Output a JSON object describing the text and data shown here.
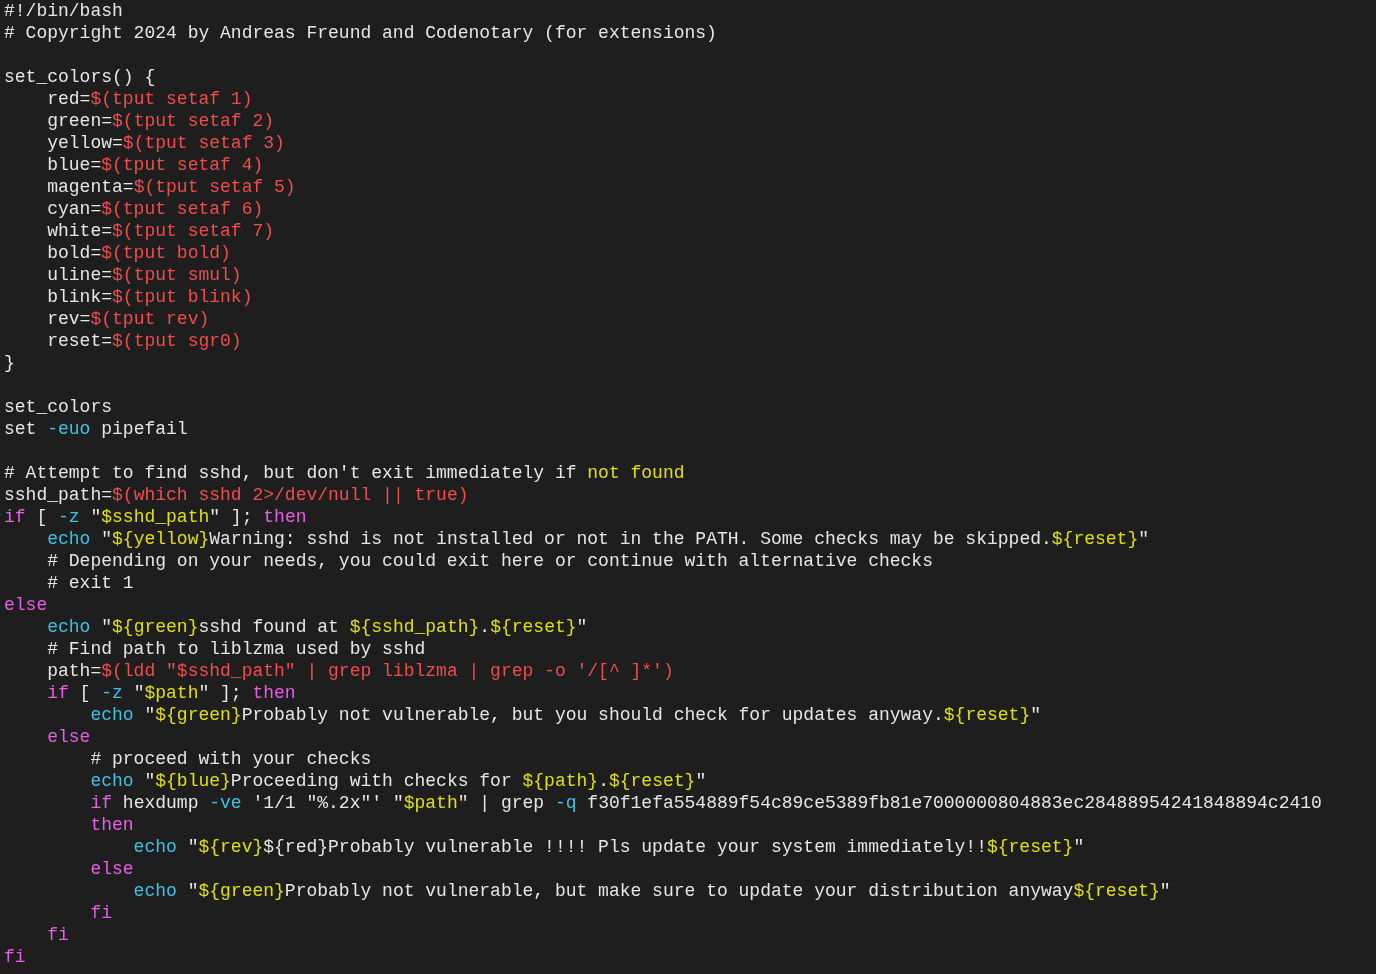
{
  "editor": {
    "lines": [
      {
        "tokens": [
          {
            "text": "#!/bin/bash",
            "color": "#e6e6e6"
          }
        ]
      },
      {
        "tokens": [
          {
            "text": "# Copyright 2024 by Andreas Freund and Codenotary (for extensions)",
            "color": "#e6e6e6"
          }
        ]
      },
      {
        "kind": "blank"
      },
      {
        "tokens": [
          {
            "text": "set_colors() {",
            "color": "#e6e6e6"
          }
        ]
      },
      {
        "tokens": [
          {
            "text": "    red=",
            "color": "#e6e6e6"
          },
          {
            "text": "$(tput setaf 1)",
            "color": "#f14c4c"
          }
        ]
      },
      {
        "tokens": [
          {
            "text": "    green=",
            "color": "#e6e6e6"
          },
          {
            "text": "$(tput setaf 2)",
            "color": "#f14c4c"
          }
        ]
      },
      {
        "tokens": [
          {
            "text": "    yellow=",
            "color": "#e6e6e6"
          },
          {
            "text": "$(tput setaf 3)",
            "color": "#f14c4c"
          }
        ]
      },
      {
        "tokens": [
          {
            "text": "    blue=",
            "color": "#e6e6e6"
          },
          {
            "text": "$(tput setaf 4)",
            "color": "#f14c4c"
          }
        ]
      },
      {
        "tokens": [
          {
            "text": "    magenta=",
            "color": "#e6e6e6"
          },
          {
            "text": "$(tput setaf 5)",
            "color": "#f14c4c"
          }
        ]
      },
      {
        "tokens": [
          {
            "text": "    cyan=",
            "color": "#e6e6e6"
          },
          {
            "text": "$(tput setaf 6)",
            "color": "#f14c4c"
          }
        ]
      },
      {
        "tokens": [
          {
            "text": "    white=",
            "color": "#e6e6e6"
          },
          {
            "text": "$(tput setaf 7)",
            "color": "#f14c4c"
          }
        ]
      },
      {
        "tokens": [
          {
            "text": "    bold=",
            "color": "#e6e6e6"
          },
          {
            "text": "$(tput bold)",
            "color": "#f14c4c"
          }
        ]
      },
      {
        "tokens": [
          {
            "text": "    uline=",
            "color": "#e6e6e6"
          },
          {
            "text": "$(tput smul)",
            "color": "#f14c4c"
          }
        ]
      },
      {
        "tokens": [
          {
            "text": "    blink=",
            "color": "#e6e6e6"
          },
          {
            "text": "$(tput blink)",
            "color": "#f14c4c"
          }
        ]
      },
      {
        "tokens": [
          {
            "text": "    rev=",
            "color": "#e6e6e6"
          },
          {
            "text": "$(tput rev)",
            "color": "#f14c4c"
          }
        ]
      },
      {
        "tokens": [
          {
            "text": "    reset=",
            "color": "#e6e6e6"
          },
          {
            "text": "$(tput sgr0)",
            "color": "#f14c4c"
          }
        ]
      },
      {
        "tokens": [
          {
            "text": "}",
            "color": "#e6e6e6"
          }
        ]
      },
      {
        "kind": "blank"
      },
      {
        "tokens": [
          {
            "text": "set_colors",
            "color": "#e6e6e6"
          }
        ]
      },
      {
        "tokens": [
          {
            "text": "set ",
            "color": "#e6e6e6"
          },
          {
            "text": "-euo",
            "color": "#3ec3e8"
          },
          {
            "text": " pipefail",
            "color": "#e6e6e6"
          }
        ]
      },
      {
        "kind": "blank"
      },
      {
        "tokens": [
          {
            "text": "# Attempt to find sshd, but don't exit immediately if ",
            "color": "#e6e6e6"
          },
          {
            "text": "not found",
            "color": "#e0e010"
          }
        ]
      },
      {
        "tokens": [
          {
            "text": "sshd_path=",
            "color": "#e6e6e6"
          },
          {
            "text": "$(which sshd 2>/dev/null || true)",
            "color": "#f14c4c"
          }
        ]
      },
      {
        "tokens": [
          {
            "text": "if",
            "color": "#e85ee8"
          },
          {
            "text": " [ ",
            "color": "#e6e6e6"
          },
          {
            "text": "-z",
            "color": "#3ec3e8"
          },
          {
            "text": " \"",
            "color": "#e6e6e6"
          },
          {
            "text": "$sshd_path",
            "color": "#e0e010"
          },
          {
            "text": "\" ]; ",
            "color": "#e6e6e6"
          },
          {
            "text": "then",
            "color": "#e85ee8"
          }
        ]
      },
      {
        "tokens": [
          {
            "text": "    echo",
            "color": "#3ec3e8"
          },
          {
            "text": " \"",
            "color": "#e6e6e6"
          },
          {
            "text": "${yellow}",
            "color": "#e0e010"
          },
          {
            "text": "Warning: sshd is not installed or not in the PATH. Some checks may be skipped.",
            "color": "#e6e6e6"
          },
          {
            "text": "${reset}",
            "color": "#e0e010"
          },
          {
            "text": "\"",
            "color": "#e6e6e6"
          }
        ]
      },
      {
        "tokens": [
          {
            "text": "    # Depending on your needs, you could exit here or continue with alternative checks",
            "color": "#e6e6e6"
          }
        ]
      },
      {
        "tokens": [
          {
            "text": "    # exit 1",
            "color": "#e6e6e6"
          }
        ]
      },
      {
        "tokens": [
          {
            "text": "else",
            "color": "#e85ee8"
          }
        ]
      },
      {
        "tokens": [
          {
            "text": "    echo",
            "color": "#3ec3e8"
          },
          {
            "text": " \"",
            "color": "#e6e6e6"
          },
          {
            "text": "${green}",
            "color": "#e0e010"
          },
          {
            "text": "sshd found at ",
            "color": "#e6e6e6"
          },
          {
            "text": "${sshd_path}",
            "color": "#e0e010"
          },
          {
            "text": "."
          },
          {
            "text": "${reset}",
            "color": "#e0e010"
          },
          {
            "text": "\"",
            "color": "#e6e6e6"
          }
        ]
      },
      {
        "tokens": [
          {
            "text": "    # Find path to liblzma used by sshd",
            "color": "#e6e6e6"
          }
        ]
      },
      {
        "tokens": [
          {
            "text": "    path=",
            "color": "#e6e6e6"
          },
          {
            "text": "$(ldd \"$sshd_path\" | grep liblzma | grep -o '/[^ ]*')",
            "color": "#f14c4c"
          }
        ]
      },
      {
        "tokens": [
          {
            "text": "    if",
            "color": "#e85ee8"
          },
          {
            "text": " [ ",
            "color": "#e6e6e6"
          },
          {
            "text": "-z",
            "color": "#3ec3e8"
          },
          {
            "text": " \"",
            "color": "#e6e6e6"
          },
          {
            "text": "$path",
            "color": "#e0e010"
          },
          {
            "text": "\" ]; ",
            "color": "#e6e6e6"
          },
          {
            "text": "then",
            "color": "#e85ee8"
          }
        ]
      },
      {
        "tokens": [
          {
            "text": "        echo",
            "color": "#3ec3e8"
          },
          {
            "text": " \"",
            "color": "#e6e6e6"
          },
          {
            "text": "${green}",
            "color": "#e0e010"
          },
          {
            "text": "Probably not vulnerable, but you should check for updates anyway.",
            "color": "#e6e6e6"
          },
          {
            "text": "${reset}",
            "color": "#e0e010"
          },
          {
            "text": "\"",
            "color": "#e6e6e6"
          }
        ]
      },
      {
        "tokens": [
          {
            "text": "    else",
            "color": "#e85ee8"
          }
        ]
      },
      {
        "tokens": [
          {
            "text": "        # proceed with your checks",
            "color": "#e6e6e6"
          }
        ]
      },
      {
        "tokens": [
          {
            "text": "        echo",
            "color": "#3ec3e8"
          },
          {
            "text": " \"",
            "color": "#e6e6e6"
          },
          {
            "text": "${blue}",
            "color": "#e0e010"
          },
          {
            "text": "Proceeding with checks for ",
            "color": "#e6e6e6"
          },
          {
            "text": "${path}",
            "color": "#e0e010"
          },
          {
            "text": "."
          },
          {
            "text": "${reset}",
            "color": "#e0e010"
          },
          {
            "text": "\"",
            "color": "#e6e6e6"
          }
        ]
      },
      {
        "tokens": [
          {
            "text": "        if",
            "color": "#e85ee8"
          },
          {
            "text": " hexdump ",
            "color": "#e6e6e6"
          },
          {
            "text": "-ve",
            "color": "#3ec3e8"
          },
          {
            "text": " '1/1 \"%.2x\"' \"",
            "color": "#e6e6e6"
          },
          {
            "text": "$path",
            "color": "#e0e010"
          },
          {
            "text": "\" | grep ",
            "color": "#e6e6e6"
          },
          {
            "text": "-q",
            "color": "#3ec3e8"
          },
          {
            "text": " f30f1efa554889f54c89ce5389fb81e7000000804883ec28488954241848894c2410",
            "color": "#e6e6e6"
          }
        ]
      },
      {
        "tokens": [
          {
            "text": "        then",
            "color": "#e85ee8"
          }
        ]
      },
      {
        "tokens": [
          {
            "text": "            echo",
            "color": "#3ec3e8"
          },
          {
            "text": " \"",
            "color": "#e6e6e6"
          },
          {
            "text": "${rev}",
            "color": "#e0e010"
          },
          {
            "text": "${red}Probably vulnerable !!!! Pls update your system immediately!!",
            "color": "#e6e6e6"
          },
          {
            "text": "${reset}",
            "color": "#e0e010"
          },
          {
            "text": "\"",
            "color": "#e6e6e6"
          }
        ]
      },
      {
        "tokens": [
          {
            "text": "        else",
            "color": "#e85ee8"
          }
        ]
      },
      {
        "tokens": [
          {
            "text": "            echo",
            "color": "#3ec3e8"
          },
          {
            "text": " \"",
            "color": "#e6e6e6"
          },
          {
            "text": "${green}",
            "color": "#e0e010"
          },
          {
            "text": "Probably not vulnerable, but make sure to update your distribution anyway",
            "color": "#e6e6e6"
          },
          {
            "text": "${reset}",
            "color": "#e0e010"
          },
          {
            "text": "\"",
            "color": "#e6e6e6"
          }
        ]
      },
      {
        "tokens": [
          {
            "text": "        fi",
            "color": "#e85ee8"
          }
        ]
      },
      {
        "tokens": [
          {
            "text": "    fi",
            "color": "#e85ee8"
          }
        ]
      },
      {
        "tokens": [
          {
            "text": "fi",
            "color": "#e85ee8"
          }
        ]
      }
    ]
  }
}
